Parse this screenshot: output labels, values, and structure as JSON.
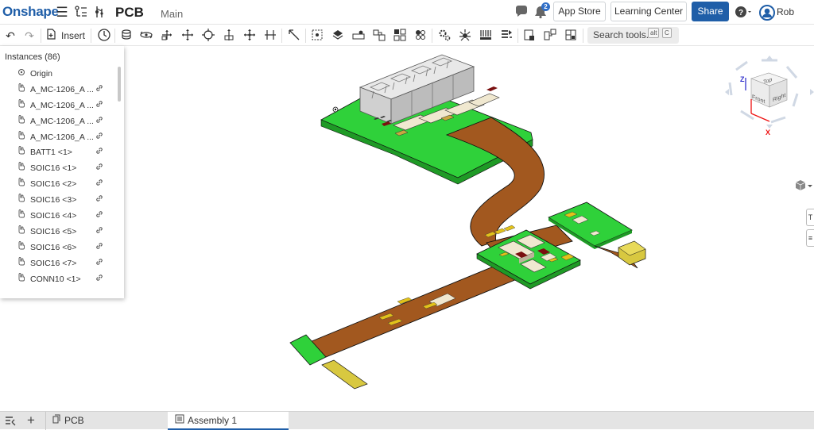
{
  "header": {
    "logo": "Onshape",
    "doc_name": "PCB",
    "workspace": "Main",
    "notification_count": "2",
    "app_store_label": "App Store",
    "learning_center_label": "Learning Center",
    "share_label": "Share",
    "user_name": "Rob"
  },
  "toolbar": {
    "insert_label": "Insert",
    "search_label": "Search tools...",
    "shortcut_alt": "alt",
    "shortcut_key": "C"
  },
  "instances": {
    "title": "Instances (86)",
    "items": [
      {
        "label": "Origin",
        "icon": "origin-icon",
        "linked": false
      },
      {
        "label": "A_MC-1206_A ...",
        "icon": "part-icon",
        "linked": true
      },
      {
        "label": "A_MC-1206_A ...",
        "icon": "part-icon",
        "linked": true
      },
      {
        "label": "A_MC-1206_A ...",
        "icon": "part-icon",
        "linked": true
      },
      {
        "label": "A_MC-1206_A ...",
        "icon": "part-icon",
        "linked": true
      },
      {
        "label": "BATT1 <1>",
        "icon": "part-icon",
        "linked": true
      },
      {
        "label": "SOIC16 <1>",
        "icon": "part-icon",
        "linked": true
      },
      {
        "label": "SOIC16 <2>",
        "icon": "part-icon",
        "linked": true
      },
      {
        "label": "SOIC16 <3>",
        "icon": "part-icon",
        "linked": true
      },
      {
        "label": "SOIC16 <4>",
        "icon": "part-icon",
        "linked": true
      },
      {
        "label": "SOIC16 <5>",
        "icon": "part-icon",
        "linked": true
      },
      {
        "label": "SOIC16 <6>",
        "icon": "part-icon",
        "linked": true
      },
      {
        "label": "SOIC16 <7>",
        "icon": "part-icon",
        "linked": true
      },
      {
        "label": "CONN10 <1>",
        "icon": "part-icon",
        "linked": true
      }
    ]
  },
  "view_cube": {
    "top": "Top",
    "front": "Front",
    "right": "Right",
    "axis_z": "Z",
    "axis_x": "X"
  },
  "tabs": [
    {
      "label": "PCB",
      "icon": "part-studio-icon",
      "active": false
    },
    {
      "label": "Assembly 1",
      "icon": "assembly-icon",
      "active": true
    }
  ],
  "colors": {
    "brand": "#1f5ea8",
    "board_green": "#2fd13a",
    "flex_copper": "#a2581f"
  }
}
